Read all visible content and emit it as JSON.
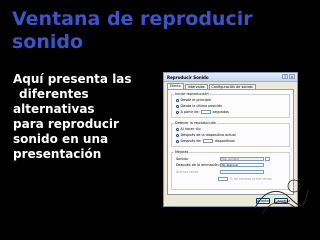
{
  "slide": {
    "title_line1": "Ventana  de reproducir",
    "title_line2": "sonido",
    "body_lines": [
      "Aquí  presenta  las",
      "diferentes",
      "alternativas",
      "para reproducir",
      "sonido  en  una",
      "presentación"
    ]
  },
  "dialog": {
    "title": "Reproducir Sonido",
    "help_label": "?",
    "close_label": "×",
    "tabs": [
      "Efecto",
      "Intervalos",
      "Configuración de sonido"
    ],
    "start_group": {
      "label": "Iniciar reproducción",
      "options": [
        "Desde el principio",
        "Desde la última posición",
        "A partir de:"
      ],
      "seconds_label": "segundos"
    },
    "stop_group": {
      "label": "Detener la reproducción",
      "options": [
        "Al hacer clic",
        "Después de la diapositiva actual",
        "Después de:"
      ],
      "slides_label": "diapositivas"
    },
    "enhance_group": {
      "label": "Mejoras",
      "sound_label": "Sonido:",
      "sound_value": "[Sin sonido]",
      "after_anim_label": "Después de la animación:",
      "after_anim_value": "No atenuar",
      "animate_text_label": "Animar texto:",
      "delay_label": "% de retraso entre letras"
    },
    "ok_label": "Aceptar",
    "cancel_label": "Cancelar"
  },
  "colors": {
    "background": "#000000",
    "title": "#3d53c8",
    "body_text": "#ffffff",
    "dialog_bg": "#ece9d8"
  }
}
